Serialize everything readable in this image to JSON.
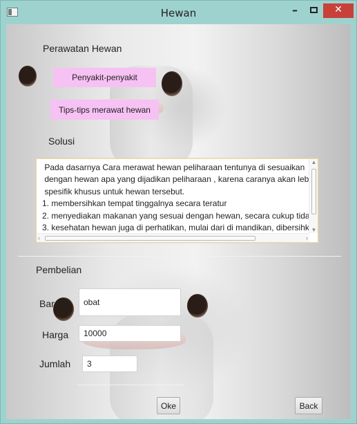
{
  "window": {
    "title": "Hewan",
    "minimize_glyph": "–",
    "close_glyph": "✕"
  },
  "care": {
    "heading": "Perawatan Hewan",
    "disease_button": "Penyakit-penyakit",
    "tips_button": "Tips-tips merawat hewan",
    "solution_label": "Solusi",
    "solution_text": " Pada dasarnya Cara merawat hewan peliharaan tentunya di sesuaikan\n dengan hewan apa yang dijadikan peliharaan , karena caranya akan lebih\n spesifik khusus untuk hewan tersebut.\n1. membersihkan tempat tinggalnya secara teratur\n2. menyediakan makanan yang sesuai dengan hewan, secara cukup tidak\n3. kesehatan hewan juga di perhatikan, mulai dari di mandikan, dibersihkan"
  },
  "purchase": {
    "heading": "Pembelian",
    "item_label": "Barang",
    "item_value": "obat",
    "price_label": "Harga",
    "price_value": "10000",
    "qty_label": "Jumlah",
    "qty_value": "3",
    "ok_button": "Oke",
    "back_button": "Back"
  },
  "colors": {
    "title_bar": "#9ed2cf",
    "pink_button": "#f6c1f3",
    "close_button": "#c8403a"
  }
}
